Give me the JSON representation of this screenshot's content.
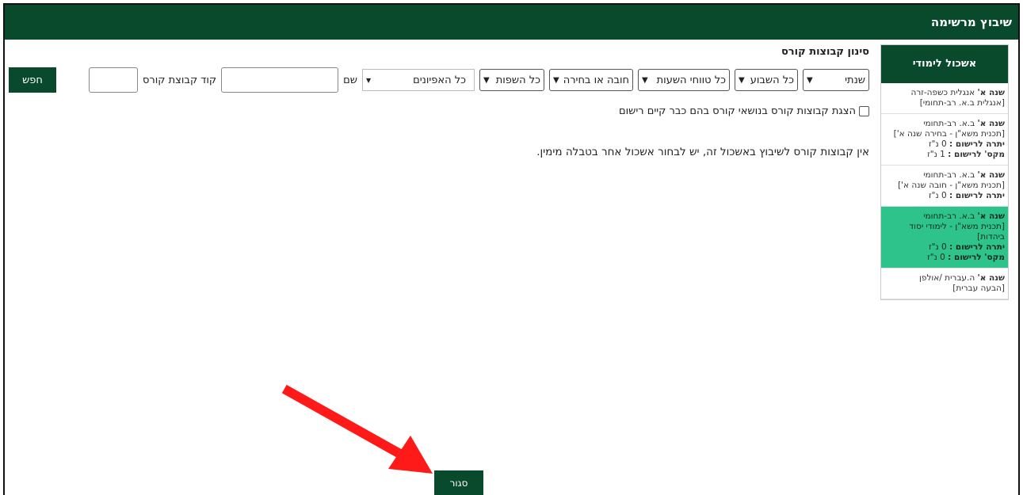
{
  "window": {
    "title": "שיבוץ מרשימה"
  },
  "sidebar": {
    "header": "אשכול לימודי",
    "groups": [
      {
        "year": "שנה א'",
        "name": "אנגלית כשפה-זרה",
        "program": "[אנגלית ב.א. רב-תחומי]",
        "left_label": "",
        "left_value": "",
        "max_label": "",
        "max_value": "",
        "active": false
      },
      {
        "year": "שנה א'",
        "name": "ב.א. רב-תחומי",
        "program": "[תכנית משא\"ן - בחירה שנה א']",
        "left_label": "יתרה לרישום :",
        "left_value": "0 נ\"ז",
        "max_label": "מקס' לרישום :",
        "max_value": "1 נ\"ז",
        "active": false
      },
      {
        "year": "שנה א'",
        "name": "ב.א. רב-תחומי",
        "program": "[תכנית משא\"ן - חובה שנה א']",
        "left_label": "יתרה לרישום :",
        "left_value": "0 נ\"ז",
        "max_label": "",
        "max_value": "",
        "active": false
      },
      {
        "year": "שנה א'",
        "name": "ב.א. רב-תחומי",
        "program": "[תכנית משא\"ן - לימודי יסוד ביהדות]",
        "left_label": "יתרה לרישום :",
        "left_value": "0 נ\"ז",
        "max_label": "מקס' לרישום :",
        "max_value": "0 נ\"ז",
        "active": true
      },
      {
        "year": "שנה א'",
        "name": "ה.עברית /אולפן",
        "program": "[הבעה עברית]",
        "left_label": "",
        "left_value": "",
        "max_label": "",
        "max_value": "",
        "active": false
      }
    ]
  },
  "filter": {
    "title": "סינון קבוצות קורס",
    "year_select": "שנתי",
    "week_select": "כל השבוע",
    "hours_select": "כל טווחי השעות",
    "type_select": "חובה או בחירה",
    "lang_select": "כל השפות",
    "feature_select": "כל האפיונים",
    "name_label": "שם",
    "name_value": "",
    "code_label": "קוד קבוצת קורס",
    "code_value": "",
    "search_button": "חפש",
    "show_existing_label": "הצגת קבוצות קורס בנושאי קורס בהם כבר קיים רישום",
    "show_existing_checked": false
  },
  "main": {
    "message": "אין קבוצות קורס לשיבוץ באשכול זה, יש לבחור אשכול אחר בטבלה מימין."
  },
  "footer": {
    "close_button": "סגור"
  },
  "colors": {
    "brand": "#084a2b",
    "active_group": "#2fc38c",
    "arrow": "#ff1a1a"
  }
}
